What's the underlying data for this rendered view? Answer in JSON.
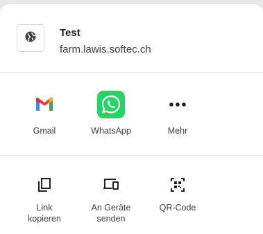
{
  "header": {
    "title": "Test",
    "url": "farm.lawis.softec.ch",
    "site_icon": "globe-icon"
  },
  "apps": [
    {
      "label": "Gmail",
      "icon": "gmail-icon"
    },
    {
      "label": "WhatsApp",
      "icon": "whatsapp-icon"
    },
    {
      "label": "Mehr",
      "icon": "more-dots-icon"
    }
  ],
  "actions": [
    {
      "label": "Link\nkopieren",
      "icon": "copy-link-icon"
    },
    {
      "label": "An Geräte\nsenden",
      "icon": "send-to-devices-icon"
    },
    {
      "label": "QR-Code",
      "icon": "qr-code-icon"
    }
  ],
  "colors": {
    "whatsapp_green": "#25d366",
    "gmail_red": "#ea4335",
    "gmail_blue": "#4285f4",
    "gmail_green": "#34a853",
    "gmail_yellow": "#fbbc04"
  }
}
